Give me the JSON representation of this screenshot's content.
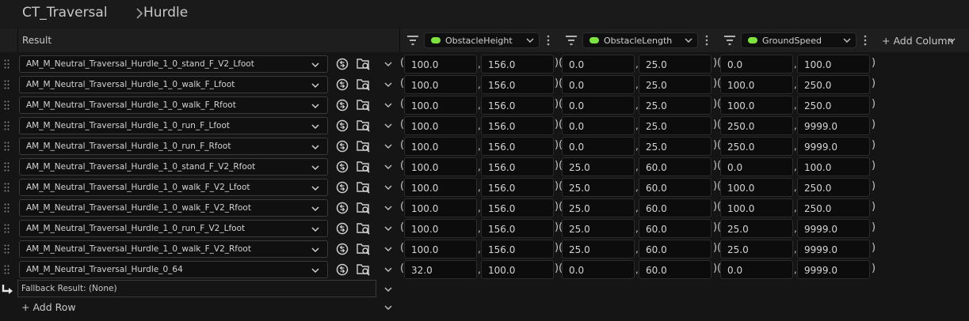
{
  "breadcrumb": {
    "items": [
      "CT_Traversal",
      "Hurdle"
    ],
    "separator_icon": "chevron-right-icon"
  },
  "header": {
    "result_label": "Result",
    "columns": [
      {
        "label": "ObstacleHeight",
        "dot_color": "#7de33f"
      },
      {
        "label": "ObstacleLength",
        "dot_color": "#7de33f"
      },
      {
        "label": "GroundSpeed",
        "dot_color": "#7de33f"
      }
    ],
    "add_column_label": "+ Add Column"
  },
  "rows": [
    {
      "asset": "AM_M_Neutral_Traversal_Hurdle_1_0_stand_F_V2_Lfoot",
      "values": [
        "100.0",
        "156.0",
        "0.0",
        "25.0",
        "0.0",
        "100.0"
      ]
    },
    {
      "asset": "AM_M_Neutral_Traversal_Hurdle_1_0_walk_F_Lfoot",
      "values": [
        "100.0",
        "156.0",
        "0.0",
        "25.0",
        "100.0",
        "250.0"
      ]
    },
    {
      "asset": "AM_M_Neutral_Traversal_Hurdle_1_0_walk_F_Rfoot",
      "values": [
        "100.0",
        "156.0",
        "0.0",
        "25.0",
        "100.0",
        "250.0"
      ]
    },
    {
      "asset": "AM_M_Neutral_Traversal_Hurdle_1_0_run_F_Lfoot",
      "values": [
        "100.0",
        "156.0",
        "0.0",
        "25.0",
        "250.0",
        "9999.0"
      ]
    },
    {
      "asset": "AM_M_Neutral_Traversal_Hurdle_1_0_run_F_Rfoot",
      "values": [
        "100.0",
        "156.0",
        "0.0",
        "25.0",
        "250.0",
        "9999.0"
      ]
    },
    {
      "asset": "AM_M_Neutral_Traversal_Hurdle_1_0_stand_F_V2_Rfoot",
      "values": [
        "100.0",
        "156.0",
        "25.0",
        "60.0",
        "0.0",
        "100.0"
      ]
    },
    {
      "asset": "AM_M_Neutral_Traversal_Hurdle_1_0_walk_F_V2_Lfoot",
      "values": [
        "100.0",
        "156.0",
        "25.0",
        "60.0",
        "100.0",
        "250.0"
      ]
    },
    {
      "asset": "AM_M_Neutral_Traversal_Hurdle_1_0_walk_F_V2_Rfoot",
      "values": [
        "100.0",
        "156.0",
        "25.0",
        "60.0",
        "100.0",
        "250.0"
      ]
    },
    {
      "asset": "AM_M_Neutral_Traversal_Hurdle_1_0_run_F_V2_Lfoot",
      "values": [
        "100.0",
        "156.0",
        "25.0",
        "60.0",
        "25.0",
        "9999.0"
      ]
    },
    {
      "asset": "AM_M_Neutral_Traversal_Hurdle_1_0_walk_F_V2_Rfoot",
      "values": [
        "100.0",
        "156.0",
        "25.0",
        "60.0",
        "25.0",
        "9999.0"
      ]
    },
    {
      "asset": "AM_M_Neutral_Traversal_Hurdle_0_64",
      "values": [
        "32.0",
        "100.0",
        "0.0",
        "60.0",
        "0.0",
        "9999.0"
      ]
    }
  ],
  "fallback": {
    "label": "Fallback Result: (None)"
  },
  "add_row_label": "+ Add Row"
}
